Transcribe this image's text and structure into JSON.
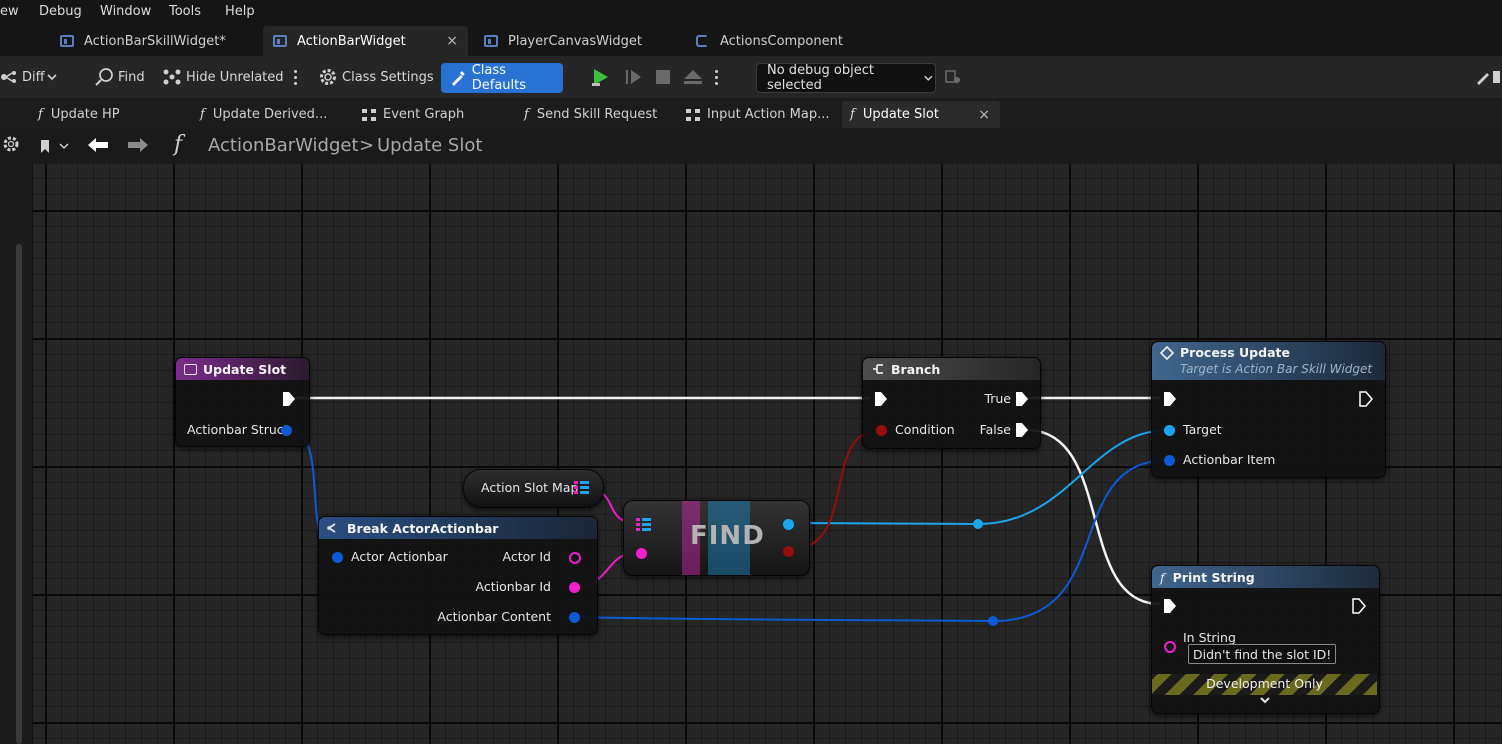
{
  "menu": {
    "items": [
      "ew",
      "Debug",
      "Window",
      "Tools",
      "Help"
    ]
  },
  "doc_tabs": [
    {
      "label": "ActionBarSkillWidget*"
    },
    {
      "label": "ActionBarWidget",
      "close": "×"
    },
    {
      "label": "PlayerCanvasWidget"
    },
    {
      "label": "ActionsComponent"
    }
  ],
  "toolbar": {
    "diff": "Diff",
    "find": "Find",
    "hide_unrelated": "Hide Unrelated",
    "class_settings": "Class Settings",
    "class_defaults": "Class Defaults",
    "debug_object": "No debug object selected"
  },
  "function_tabs": [
    {
      "label": "Update HP",
      "icon": "function-icon"
    },
    {
      "label": "Update Derived...",
      "icon": "function-icon"
    },
    {
      "label": "Event Graph",
      "icon": "graph-icon"
    },
    {
      "label": "Send Skill Request",
      "icon": "function-icon"
    },
    {
      "label": "Input Action Map...",
      "icon": "graph-icon"
    },
    {
      "label": "Update Slot",
      "icon": "function-icon",
      "close": "×"
    }
  ],
  "breadcrumb": {
    "root": "ActionBarWidget",
    "separator": ">",
    "current": "Update Slot"
  },
  "nodes": {
    "update_slot": {
      "title": "Update Slot",
      "pin": "Actionbar Struct"
    },
    "break": {
      "title": "Break ActorActionbar",
      "in_pin": "Actor Actionbar",
      "out_pins": [
        "Actor Id",
        "Actionbar Id",
        "Actionbar Content"
      ]
    },
    "action_slot_map": {
      "label": "Action Slot Map"
    },
    "find": {
      "label": "FIND"
    },
    "branch": {
      "title": "Branch",
      "condition": "Condition",
      "true_label": "True",
      "false_label": "False"
    },
    "process_update": {
      "title": "Process Update",
      "subtitle": "Target is Action Bar Skill Widget",
      "pins": [
        "Target",
        "Actionbar Item"
      ]
    },
    "print_string": {
      "title": "Print String",
      "pin": "In String",
      "value": "Didn't find the slot ID!",
      "dev_only": "Development Only"
    }
  },
  "colors": {
    "struct_pin": "#0d5ad8",
    "object_pin": "#1aa6ee",
    "int_pin": "#f01ecc",
    "bool_pin": "#980d0d",
    "class_defaults_button": "#2872d4",
    "function_header": "#3b6391",
    "event_header": "#5a2a6e"
  }
}
